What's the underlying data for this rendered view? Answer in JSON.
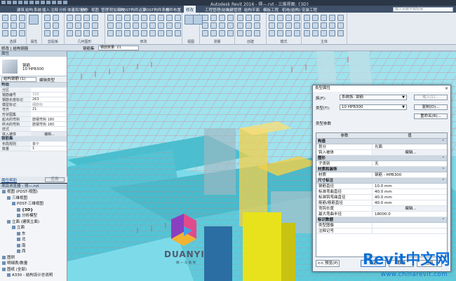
{
  "app": {
    "title": "Autodesk Revit 2016 -   得—.rvt - 三维视图: {3D}",
    "search_placeholder": "键入关键字或短语"
  },
  "tabs": [
    "建筑",
    "结构",
    "系统",
    "插入",
    "注释",
    "分析",
    "体量和场地",
    "协作",
    "视图",
    "管理",
    "附加模块",
    "PDST构件运算",
    "PDST构件表格",
    "构件布置",
    "修改",
    "工程管理(结构)",
    "上建管理",
    "结构平面",
    "模板工程",
    "机电(结构)",
    "安装工程"
  ],
  "active_tab_index": 14,
  "ribbon_groups": [
    "选择",
    "属性",
    "剪贴板",
    "几何图形",
    "修改",
    "视图",
    "测量",
    "创建",
    "模式",
    "主体"
  ],
  "options_bar": {
    "label": "修改 | 结构钢筋",
    "field_label": "钢筋集",
    "field_value": "钢筋数量: 21"
  },
  "properties": {
    "header": "属性",
    "type_name_1": "钢筋",
    "type_name_2": "10 HPB300",
    "instance_selector": "结构钢筋 (1)",
    "edit_type": "编辑类型",
    "categories": [
      {
        "name": "构造",
        "rows": [
          {
            "k": "分区",
            "v": "",
            "grey": false
          },
          {
            "k": "钢筋编号",
            "v": "320",
            "grey": true
          },
          {
            "k": "钢筋长度标记",
            "v": "263",
            "grey": false
          },
          {
            "k": "模型标记",
            "v": "细筋标",
            "grey": true
          },
          {
            "k": "弯齐",
            "v": "21",
            "grey": false
          },
          {
            "k": "形状图集",
            "v": "",
            "grey": true
          },
          {
            "k": "起点的弯钩",
            "v": "筋钢弯钩 180",
            "grey": false
          },
          {
            "k": "终点的弯钩",
            "v": "筋钢弯钩 180",
            "grey": false
          },
          {
            "k": "样式",
            "v": "",
            "grey": false
          },
          {
            "k": "体入被体",
            "v": "编辑...",
            "grey": false,
            "btn": true
          }
        ]
      },
      {
        "name": "钢筋集",
        "rows": [
          {
            "k": "布局规则",
            "v": "单个",
            "grey": false
          },
          {
            "k": "数量",
            "v": "1",
            "grey": false
          }
        ]
      }
    ],
    "help_link": "属性帮助",
    "apply": "应用"
  },
  "browser": {
    "header": "项目浏览器 - 得—.rvt",
    "nodes": [
      {
        "label": "视图 (PDST-视图)",
        "indent": 0,
        "bold": false
      },
      {
        "label": "三维视图",
        "indent": 1,
        "bold": false
      },
      {
        "label": "PDST-三维视图",
        "indent": 2,
        "bold": false
      },
      {
        "label": "{3D}",
        "indent": 3,
        "bold": true
      },
      {
        "label": "分析模型",
        "indent": 3,
        "bold": false
      },
      {
        "label": "立面 (建筑立面)",
        "indent": 1,
        "bold": false
      },
      {
        "label": "立面",
        "indent": 2,
        "bold": false
      },
      {
        "label": "东",
        "indent": 3,
        "bold": false
      },
      {
        "label": "北",
        "indent": 3,
        "bold": false
      },
      {
        "label": "南",
        "indent": 3,
        "bold": false
      },
      {
        "label": "西",
        "indent": 3,
        "bold": false
      },
      {
        "label": "图例",
        "indent": 0,
        "bold": false
      },
      {
        "label": "明细表/数量",
        "indent": 0,
        "bold": false
      },
      {
        "label": "图纸 (全部)",
        "indent": 0,
        "bold": false
      },
      {
        "label": "A330 - 结构设计总说明",
        "indent": 1,
        "bold": false
      }
    ]
  },
  "dialog": {
    "title": "类型属性",
    "family_label": "族(F):",
    "family_value": "系统族: 钢筋",
    "type_label": "类型(T):",
    "type_value": "10 HPB300",
    "load_btn": "载入(L)...",
    "dup_btn": "复制(D)...",
    "rename_btn": "重命名(R)...",
    "section": "类型参数",
    "col_param": "参数",
    "col_value": "值",
    "groups": [
      {
        "name": "构造",
        "rows": [
          {
            "k": "划分",
            "v": "光面"
          },
          {
            "k": "钩入被体",
            "v": "编辑...",
            "btn": true
          }
        ]
      },
      {
        "name": "图形",
        "rows": [
          {
            "k": "子类别",
            "v": "无"
          }
        ]
      },
      {
        "name": "材质和装饰",
        "rows": [
          {
            "k": "材质",
            "v": "钢筋 - HPB300"
          }
        ]
      },
      {
        "name": "尺寸标注",
        "rows": [
          {
            "k": "钢筋直径",
            "v": "10.0 mm"
          },
          {
            "k": "标准弯曲直径",
            "v": "40.0 mm"
          },
          {
            "k": "标准钩弯曲直径",
            "v": "40.0 mm"
          },
          {
            "k": "筋筋/筋筋直径",
            "v": "40.0 mm"
          },
          {
            "k": "弯钩长度",
            "v": "编辑...",
            "btn": true
          },
          {
            "k": "最大弯曲半径",
            "v": "18000.0"
          }
        ]
      },
      {
        "name": "标识数据",
        "rows": [
          {
            "k": "类型图像",
            "v": ""
          },
          {
            "k": "注释记号",
            "v": ""
          }
        ]
      }
    ],
    "preview_btn": "<< 预览(P)",
    "ok_btn": "确定",
    "cancel_btn": "取消",
    "apply_btn": "应用"
  },
  "logo": {
    "name": "DUANYI",
    "sub": "端 一 与 筋 经"
  },
  "watermark": {
    "brand_latin": "Revit",
    "brand_cn": "中文网",
    "url": "www.chinarevit.com"
  },
  "colors": {
    "cyan": "#6fd6e6",
    "rebar": "#e0707a",
    "yellow_column": "#e8e21c",
    "selected": "#f2d04a"
  }
}
